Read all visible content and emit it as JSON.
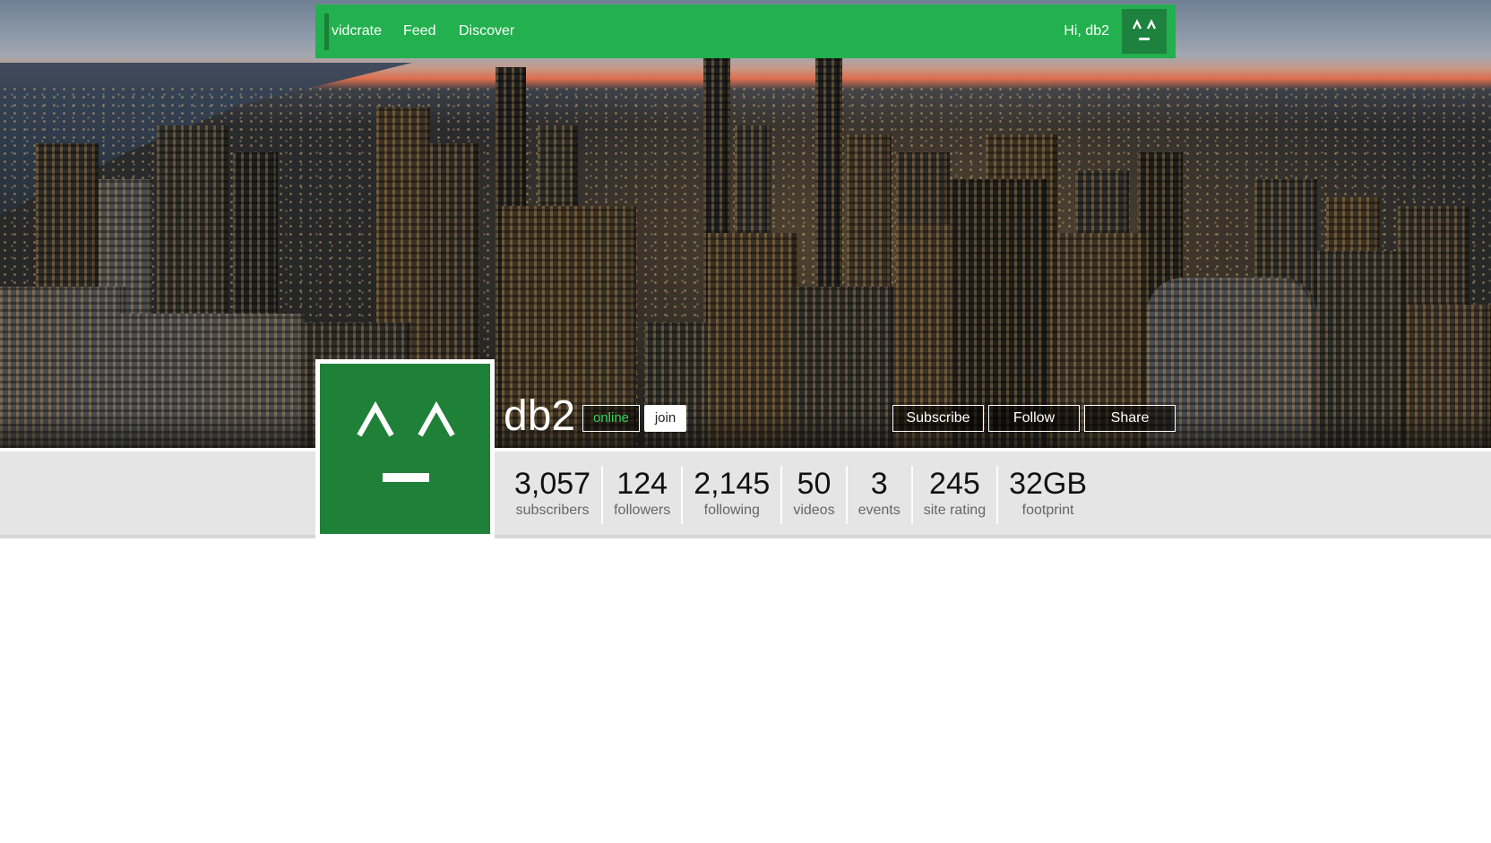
{
  "navbar": {
    "brand": "vidcrate",
    "links": [
      "Feed",
      "Discover"
    ],
    "greeting": "Hi, db2",
    "avatar_icon": "smiley-face-icon"
  },
  "profile": {
    "username": "db2",
    "status": "online",
    "join_label": "join",
    "avatar_icon": "smiley-face-icon"
  },
  "actions": {
    "subscribe": "Subscribe",
    "follow": "Follow",
    "share": "Share"
  },
  "stats": [
    {
      "value": "3,057",
      "label": "subscribers"
    },
    {
      "value": "124",
      "label": "followers"
    },
    {
      "value": "2,145",
      "label": "following"
    },
    {
      "value": "50",
      "label": "videos"
    },
    {
      "value": "3",
      "label": "events"
    },
    {
      "value": "245",
      "label": "site rating"
    },
    {
      "value": "32GB",
      "label": "footprint"
    }
  ],
  "colors": {
    "brand_green": "#23b04e",
    "avatar_green": "#1f8038",
    "status_green": "#2fd25c",
    "strip_gray": "#e5e5e5"
  }
}
